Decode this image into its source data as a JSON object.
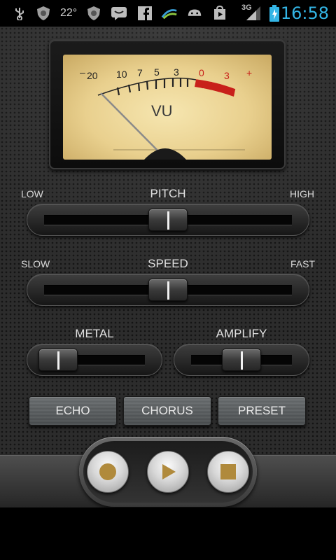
{
  "status_bar": {
    "temperature": "22°",
    "network": "3G",
    "time": "16:58",
    "icons": [
      "usb-icon",
      "shield-icon",
      "shield-icon",
      "chat-icon",
      "facebook-icon",
      "swype-icon",
      "android-icon",
      "play-store-icon",
      "signal-icon",
      "battery-icon"
    ]
  },
  "vu_meter": {
    "label": "VU",
    "scale": [
      "–",
      "20",
      "10",
      "7",
      "5",
      "3",
      "0",
      "3",
      "+"
    ],
    "needle_level": "-20"
  },
  "sliders": {
    "pitch": {
      "title": "PITCH",
      "min_label": "LOW",
      "max_label": "HIGH",
      "value": 0.5
    },
    "speed": {
      "title": "SPEED",
      "min_label": "SLOW",
      "max_label": "FAST",
      "value": 0.5
    },
    "metal": {
      "title": "METAL",
      "value": 0.0
    },
    "amplify": {
      "title": "AMPLIFY",
      "value": 0.5
    }
  },
  "effects": {
    "echo": "ECHO",
    "chorus": "CHORUS",
    "preset": "PRESET"
  },
  "transport": {
    "record": "record-icon",
    "play": "play-icon",
    "stop": "stop-icon"
  },
  "colors": {
    "accent_gold": "#b08a3c",
    "vu_red": "#c8201a",
    "status_time": "#33b5e5"
  }
}
